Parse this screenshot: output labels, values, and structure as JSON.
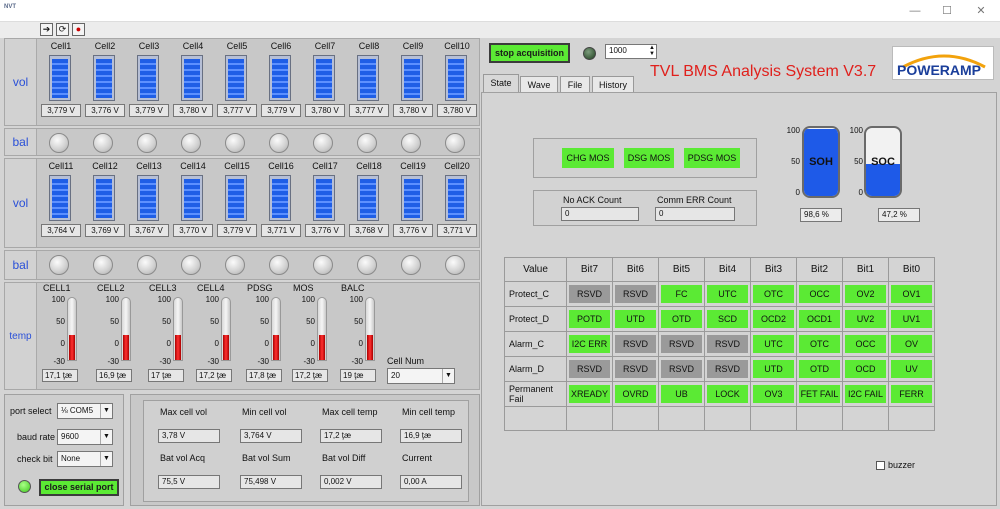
{
  "app": {
    "title": "TVL BMS Analysis System V3.7",
    "logo": "POWERAMP",
    "titlebar_label": "NVT"
  },
  "toolbar": {
    "run": "➔",
    "cycle": "⟳",
    "stop": "●"
  },
  "cells_top": {
    "label": "vol",
    "names": [
      "Cell1",
      "Cell2",
      "Cell3",
      "Cell4",
      "Cell5",
      "Cell6",
      "Cell7",
      "Cell8",
      "Cell9",
      "Cell10"
    ],
    "values": [
      "3,779 V",
      "3,776 V",
      "3,779 V",
      "3,780 V",
      "3,777 V",
      "3,779 V",
      "3,780 V",
      "3,777 V",
      "3,780 V",
      "3,780 V"
    ]
  },
  "bal_label": "bal",
  "cells_bottom": {
    "label": "vol",
    "names": [
      "Cell11",
      "Cell12",
      "Cell13",
      "Cell14",
      "Cell15",
      "Cell16",
      "Cell17",
      "Cell18",
      "Cell19",
      "Cell20"
    ],
    "values": [
      "3,764 V",
      "3,769 V",
      "3,767 V",
      "3,770 V",
      "3,779 V",
      "3,771 V",
      "3,776 V",
      "3,768 V",
      "3,776 V",
      "3,771 V"
    ]
  },
  "temp": {
    "label": "temp",
    "names": [
      "CELL1",
      "CELL2",
      "CELL3",
      "CELL4",
      "PDSG",
      "MOS",
      "BALC"
    ],
    "values": [
      "17,1 ţæ",
      "16,9 ţæ",
      "17 ţæ",
      "17,2 ţæ",
      "17,8 ţæ",
      "17,2 ţæ",
      "19 ţæ"
    ],
    "scale": [
      "100",
      "50",
      "0",
      "-30"
    ],
    "cell_num_label": "Cell Num",
    "cell_num_value": "20"
  },
  "serial": {
    "port_label": "port select",
    "port_value": "COM5",
    "port_prefix": "⅛",
    "baud_label": "baud rate",
    "baud_value": "9600",
    "check_label": "check bit",
    "check_value": "None",
    "close_button": "close serial port"
  },
  "stats": {
    "labels": [
      "Max cell vol",
      "Min cell vol",
      "Max cell temp",
      "Min cell temp",
      "Bat vol Acq",
      "Bat vol Sum",
      "Bat vol Diff",
      "Current"
    ],
    "values": [
      "3,78 V",
      "3,764 V",
      "17,2 ţæ",
      "16,9 ţæ",
      "75,5 V",
      "75,498 V",
      "0,002 V",
      "0,00 A"
    ]
  },
  "acquisition": {
    "button": "stop acquisition",
    "interval": "1000"
  },
  "tabs": [
    "State",
    "Wave",
    "File",
    "History"
  ],
  "mos": {
    "chg": "CHG MOS",
    "dsg": "DSG MOS",
    "pdsg": "PDSG MOS"
  },
  "counts": {
    "no_ack_label": "No ACK Count",
    "no_ack_value": "0",
    "comm_err_label": "Comm ERR Count",
    "comm_err_value": "0"
  },
  "soh": {
    "label": "SOH",
    "value": "98,6 %",
    "level": 0.986,
    "scale": [
      "100",
      "50",
      "0"
    ]
  },
  "soc": {
    "label": "SOC",
    "value": "47,2 %",
    "level": 0.472,
    "scale": [
      "100",
      "50",
      "0"
    ]
  },
  "bits": {
    "header": [
      "Value",
      "Bit7",
      "Bit6",
      "Bit5",
      "Bit4",
      "Bit3",
      "Bit2",
      "Bit1",
      "Bit0"
    ],
    "rows": [
      {
        "label": "Protect_C",
        "cells": [
          [
            "RSVD",
            "s"
          ],
          [
            "RSVD",
            "s"
          ],
          [
            "FC",
            "g"
          ],
          [
            "UTC",
            "g"
          ],
          [
            "OTC",
            "g"
          ],
          [
            "OCC",
            "g"
          ],
          [
            "OV2",
            "g"
          ],
          [
            "OV1",
            "g"
          ]
        ]
      },
      {
        "label": "Protect_D",
        "cells": [
          [
            "POTD",
            "g"
          ],
          [
            "UTD",
            "g"
          ],
          [
            "OTD",
            "g"
          ],
          [
            "SCD",
            "g"
          ],
          [
            "OCD2",
            "g"
          ],
          [
            "OCD1",
            "g"
          ],
          [
            "UV2",
            "g"
          ],
          [
            "UV1",
            "g"
          ]
        ]
      },
      {
        "label": "Alarm_C",
        "cells": [
          [
            "I2C ERR",
            "g"
          ],
          [
            "RSVD",
            "s"
          ],
          [
            "RSVD",
            "s"
          ],
          [
            "RSVD",
            "s"
          ],
          [
            "UTC",
            "g"
          ],
          [
            "OTC",
            "g"
          ],
          [
            "OCC",
            "g"
          ],
          [
            "OV",
            "g"
          ]
        ]
      },
      {
        "label": "Alarm_D",
        "cells": [
          [
            "RSVD",
            "s"
          ],
          [
            "RSVD",
            "s"
          ],
          [
            "RSVD",
            "s"
          ],
          [
            "RSVD",
            "s"
          ],
          [
            "UTD",
            "g"
          ],
          [
            "OTD",
            "g"
          ],
          [
            "OCD",
            "g"
          ],
          [
            "UV",
            "g"
          ]
        ]
      },
      {
        "label": "Permanent Fail",
        "cells": [
          [
            "XREADY",
            "g"
          ],
          [
            "OVRD",
            "g"
          ],
          [
            "UB",
            "g"
          ],
          [
            "LOCK",
            "g"
          ],
          [
            "OV3",
            "g"
          ],
          [
            "FET FAIL",
            "g"
          ],
          [
            "I2C FAIL",
            "g"
          ],
          [
            "FERR",
            "g"
          ]
        ]
      }
    ]
  },
  "buzzer": "buzzer"
}
